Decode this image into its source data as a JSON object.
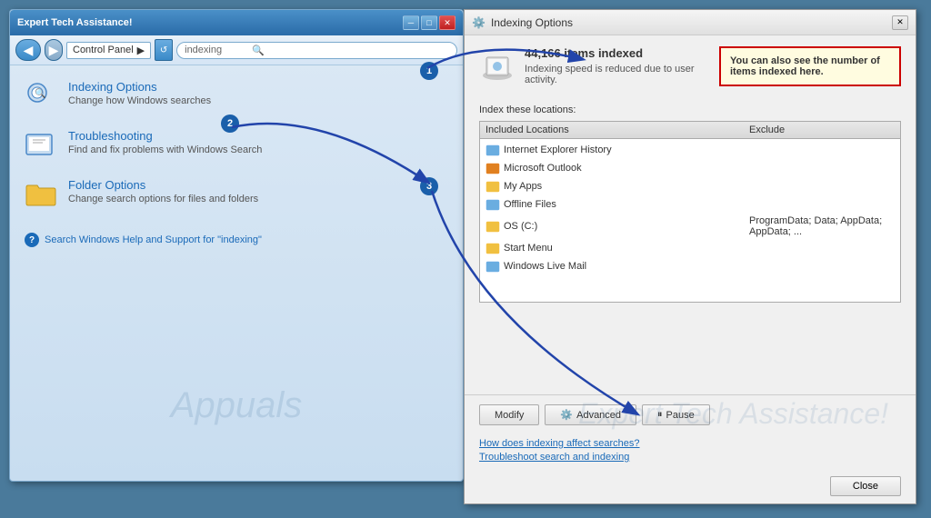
{
  "left_window": {
    "title": "Expert Tech Assistance!",
    "address": "Control Panel",
    "search_value": "indexing",
    "items": [
      {
        "name": "indexing-options",
        "title": "Indexing Options",
        "description": "Change how Windows searches"
      },
      {
        "name": "troubleshooting",
        "title": "Troubleshooting",
        "description": "Find and fix problems with Windows Search"
      },
      {
        "name": "folder-options",
        "title": "Folder Options",
        "description": "Change search options for files and folders"
      }
    ],
    "help_link": "Search Windows Help and Support for \"indexing\"",
    "watermark": "Appuals"
  },
  "right_window": {
    "title": "Indexing Options",
    "callout": "You can also see the number of items indexed here.",
    "items_count": "44,166 items indexed",
    "speed_note": "Indexing speed is reduced due to user activity.",
    "section_label": "Index these locations:",
    "table": {
      "col_included": "Included Locations",
      "col_exclude": "Exclude",
      "rows": [
        {
          "name": "Internet Explorer History",
          "exclude": ""
        },
        {
          "name": "Microsoft Outlook",
          "exclude": ""
        },
        {
          "name": "My Apps",
          "exclude": ""
        },
        {
          "name": "Offline Files",
          "exclude": ""
        },
        {
          "name": "OS (C:)",
          "exclude": "ProgramData; Data; AppData; AppData; ..."
        },
        {
          "name": "Start Menu",
          "exclude": ""
        },
        {
          "name": "Windows Live Mail",
          "exclude": ""
        }
      ]
    },
    "buttons": {
      "modify": "Modify",
      "advanced": "Advanced",
      "pause": "Pause"
    },
    "links": [
      "How does indexing affect searches?",
      "Troubleshoot search and indexing"
    ],
    "close_label": "Close",
    "watermark": "Expert Tech Assistance!"
  },
  "steps": {
    "badge1": "1",
    "badge2": "2",
    "badge3": "3"
  }
}
